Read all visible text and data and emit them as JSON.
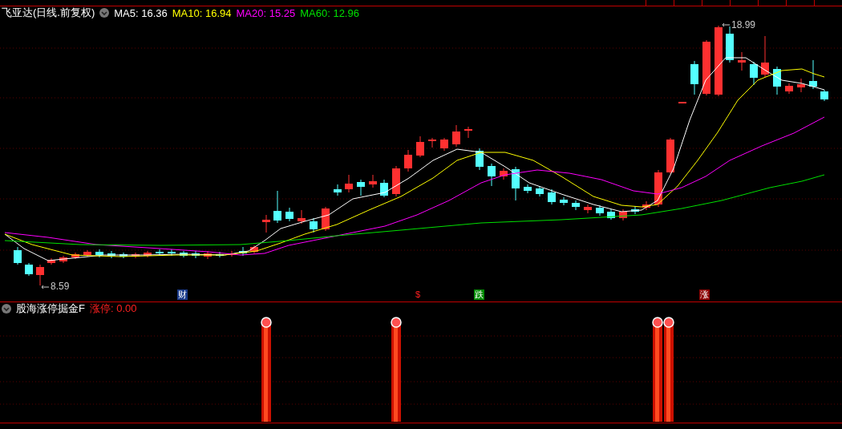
{
  "stock_header": {
    "title": "飞亚达(日线.前复权)",
    "indicators": [
      {
        "label": "MA5: 16.36",
        "color": "#ffffff"
      },
      {
        "label": "MA10: 16.94",
        "color": "#ffff00"
      },
      {
        "label": "MA20: 15.25",
        "color": "#ff00ff"
      },
      {
        "label": "MA60: 12.96",
        "color": "#00e000"
      }
    ]
  },
  "chart": {
    "high_label": "18.99",
    "low_label": "8.59",
    "event_markers": [
      {
        "text": "财",
        "kind": "finance"
      },
      {
        "text": "$",
        "kind": "dollar"
      },
      {
        "text": "跌",
        "kind": "fall"
      },
      {
        "text": "涨",
        "kind": "rise"
      }
    ]
  },
  "indicator_panel": {
    "title": "股海涨停掘金F",
    "reading": "涨停: 0.00"
  }
}
